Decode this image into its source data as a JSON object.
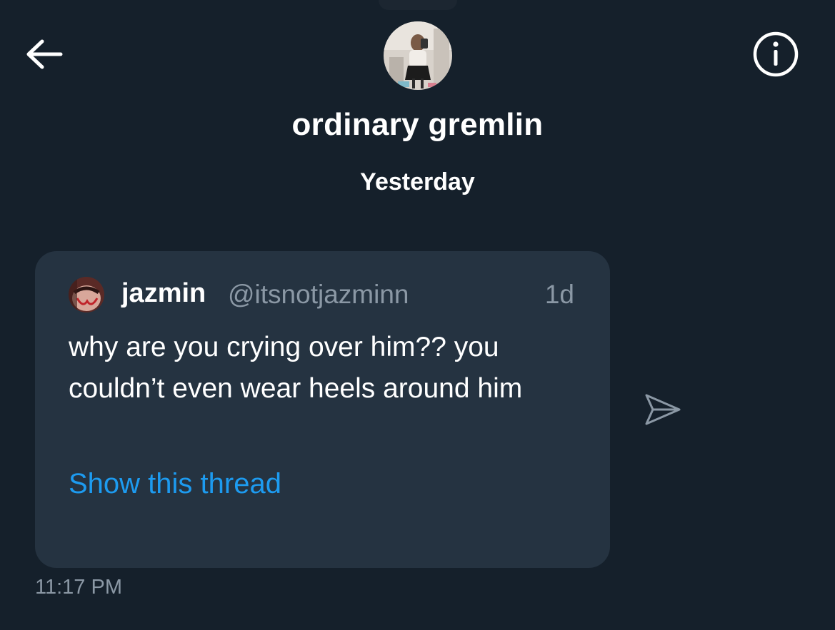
{
  "header": {
    "title": "ordinary gremlin",
    "back_icon": "arrow-left-icon",
    "info_icon": "info-circle-icon",
    "avatar_icon": "profile-photo"
  },
  "conversation": {
    "date_label": "Yesterday"
  },
  "message": {
    "tweet": {
      "author_name": "jazmin",
      "author_handle": "@itsnotjazminn",
      "time_ago": "1d",
      "text": "why are you crying over him?? you couldn’t even wear heels around him",
      "thread_link_label": "Show this thread",
      "avatar_icon": "author-avatar"
    },
    "share_icon": "send-icon",
    "timestamp": "11:17 PM"
  },
  "colors": {
    "background": "#15202b",
    "card": "#253341",
    "accent": "#1d9bf0",
    "secondary_text": "#8b98a5"
  }
}
